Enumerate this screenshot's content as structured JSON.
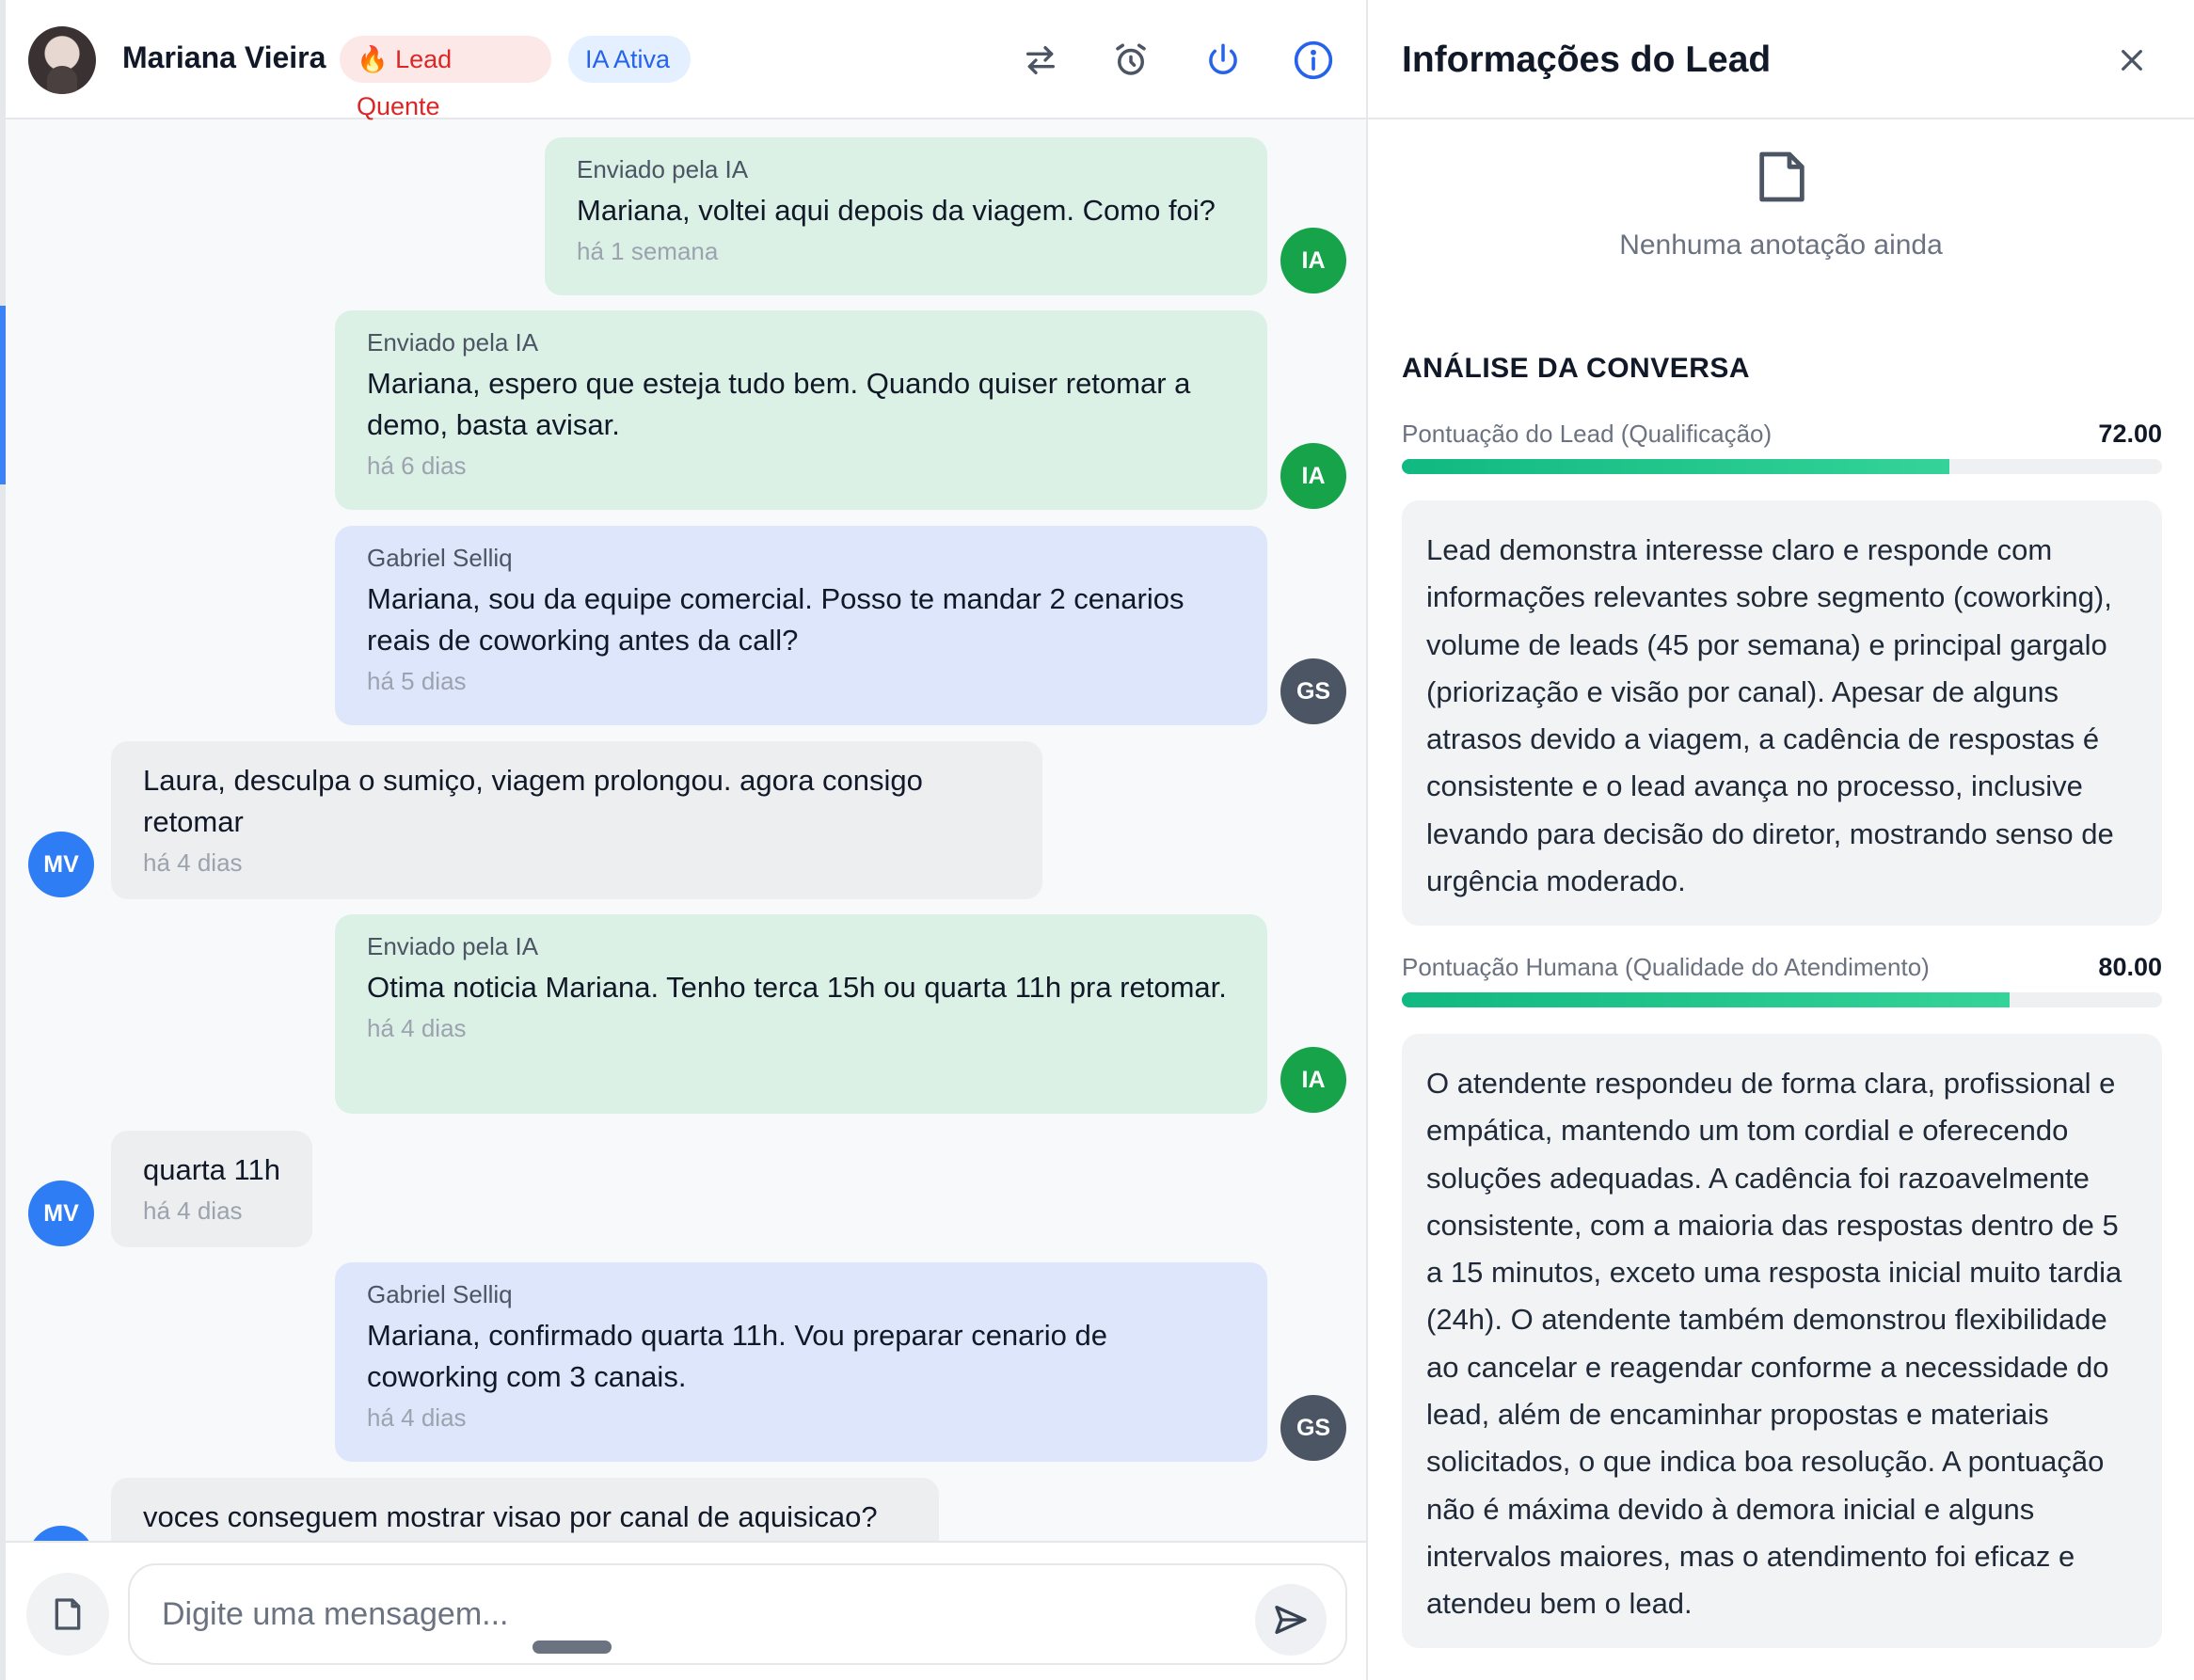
{
  "chat": {
    "contact_name": "Mariana Vieira",
    "lead_badge": "🔥 Lead Quente",
    "ai_badge": "IA Ativa",
    "messages": [
      {
        "type": "ia",
        "sender": "Enviado pela IA",
        "text": "Mariana, voltei aqui depois da viagem. Como foi?",
        "time": "há 1 semana",
        "avatar": "IA"
      },
      {
        "type": "ia",
        "sender": "Enviado pela IA",
        "text": "Mariana, espero que esteja tudo bem. Quando quiser retomar a demo, basta avisar.",
        "time": "há 6 dias",
        "avatar": "IA"
      },
      {
        "type": "human",
        "sender": "Gabriel Selliq",
        "text": "Mariana, sou da equipe comercial. Posso te mandar 2 cenarios reais de coworking antes da call?",
        "time": "há 5 dias",
        "avatar": "GS"
      },
      {
        "type": "lead",
        "sender": "",
        "text": "Laura, desculpa o sumiço, viagem prolongou. agora consigo retomar",
        "time": "há 4 dias",
        "avatar": "MV"
      },
      {
        "type": "ia",
        "sender": "Enviado pela IA",
        "text": "Otima noticia Mariana. Tenho terca 15h ou quarta 11h pra retomar.",
        "time": "há 4 dias",
        "avatar": "IA"
      },
      {
        "type": "lead",
        "sender": "",
        "text": "quarta 11h",
        "time": "há 4 dias",
        "avatar": "MV"
      },
      {
        "type": "human",
        "sender": "Gabriel Selliq",
        "text": "Mariana, confirmado quarta 11h. Vou preparar cenario de coworking com 3 canais.",
        "time": "há 4 dias",
        "avatar": "GS"
      },
      {
        "type": "lead",
        "sender": "",
        "text": "voces conseguem mostrar visao por canal de aquisicao?",
        "time": "",
        "avatar": "MV"
      }
    ],
    "input_placeholder": "Digite uma mensagem..."
  },
  "info": {
    "title": "Informações do Lead",
    "notes_empty": "Nenhuma anotação ainda",
    "analysis_title": "ANÁLISE DA CONVERSA",
    "lead_score": {
      "label": "Pontuação do Lead (Qualificação)",
      "value": "72.00",
      "fraction": 0.72,
      "text": "Lead demonstra interesse claro e responde com informações relevantes sobre segmento (coworking), volume de leads (45 por semana) e principal gargalo (priorização e visão por canal). Apesar de alguns atrasos devido a viagem, a cadência de respostas é consistente e o lead avança no processo, inclusive levando para decisão do diretor, mostrando senso de urgência moderado."
    },
    "human_score": {
      "label": "Pontuação Humana (Qualidade do Atendimento)",
      "value": "80.00",
      "fraction": 0.8,
      "text": "O atendente respondeu de forma clara, profissional e empática, mantendo um tom cordial e oferecendo soluções adequadas. A cadência foi razoavelmente consistente, com a maioria das respostas dentro de 5 a 15 minutos, exceto uma resposta inicial muito tardia (24h). O atendente também demonstrou flexibilidade ao cancelar e reagendar conforme a necessidade do lead, além de encaminhar propostas e materiais solicitados, o que indica boa resolução. A pontuação não é máxima devido à demora inicial e alguns intervalos maiores, mas o atendimento foi eficaz e atendeu bem o lead."
    }
  },
  "colors": {
    "ia_bubble": "#dbf1e6",
    "human_bubble": "#dde6fb",
    "lead_bubble": "#edeef0",
    "ia_avatar": "#16a34a",
    "human_avatar": "#4b5563",
    "lead_avatar": "#2f7df5",
    "accent": "#2563eb",
    "score_bar": "#10b981"
  },
  "icons": [
    "transfer-icon",
    "alarm-clock-icon",
    "power-icon",
    "info-icon",
    "close-icon",
    "note-icon",
    "attach-file-icon",
    "send-icon"
  ]
}
